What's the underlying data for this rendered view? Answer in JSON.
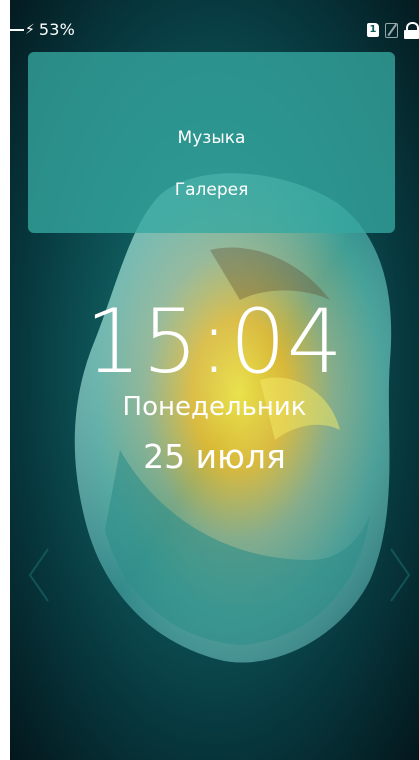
{
  "status_bar": {
    "battery_percent": "53%",
    "sim1_label": "1"
  },
  "shortcuts": {
    "music_label": "Музыка",
    "gallery_label": "Галерея"
  },
  "lock_screen": {
    "time": "15:04",
    "weekday": "Понедельник",
    "date": "25 июля"
  },
  "colors": {
    "background_teal": "#0f5a5c",
    "panel_teal": "#36a8a0",
    "text": "#ffffff"
  },
  "icons": [
    "charging-icon",
    "sim1-icon",
    "sim2-disabled-icon",
    "lock-icon",
    "left-arrow-icon",
    "right-arrow-icon"
  ]
}
